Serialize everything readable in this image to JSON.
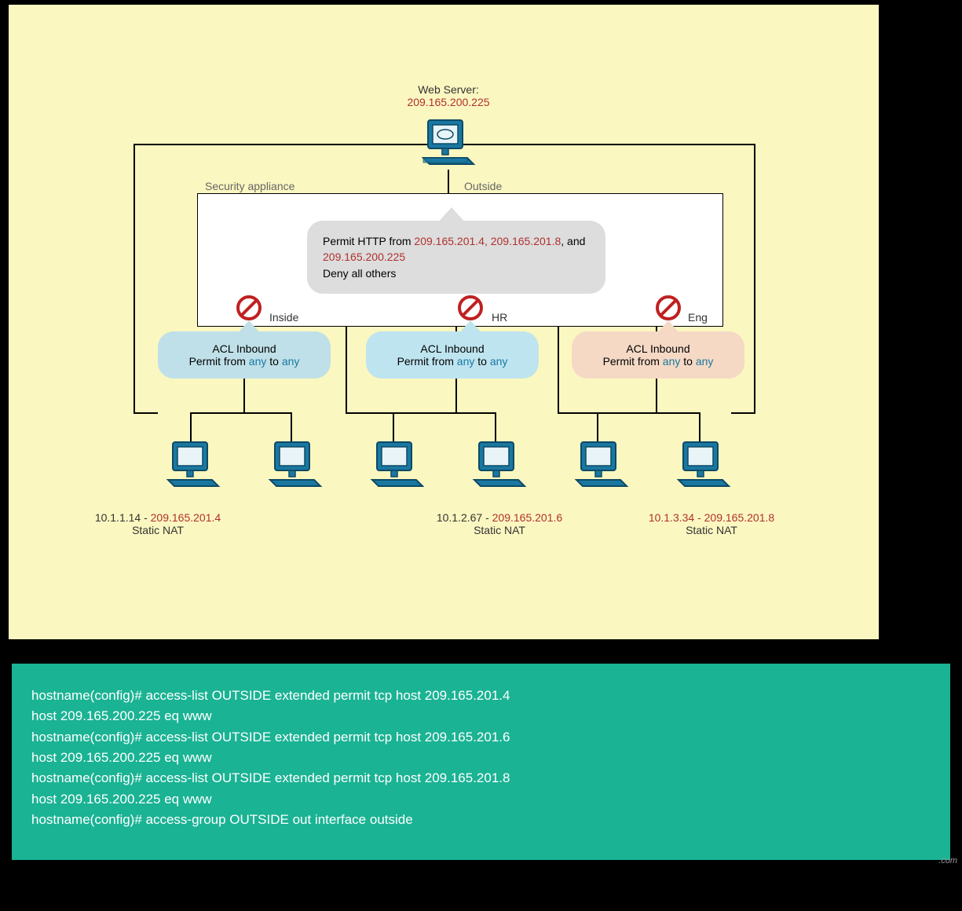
{
  "webserver": {
    "title": "Web Server:",
    "ip": "209.165.200.225"
  },
  "appliance": {
    "label_left": "Security appliance",
    "label_right": "Outside"
  },
  "callout": {
    "prefix": "Permit HTTP from ",
    "ip1": "209.165.201.4,",
    "ip2": "209.165.201.8",
    "mid": ", and ",
    "ip3": "209.165.200.225",
    "line2": "Deny all others"
  },
  "zones": {
    "inside": "Inside",
    "hr": "HR",
    "eng": "Eng"
  },
  "acl": {
    "title": "ACL Inbound",
    "prefix": "Permit from ",
    "any": "any",
    "sep": " to "
  },
  "hosts": {
    "h1_private": "10.1.1.14 - ",
    "h1_public": "209.165.201.4",
    "h2_private": "10.1.2.67 - ",
    "h2_public": "209.165.201.6",
    "h3_private": "10.1.3.34 - ",
    "h3_public": "209.165.201.8",
    "nat": "Static NAT"
  },
  "code": {
    "l1": "hostname(config)# access-list OUTSIDE extended permit tcp host 209.165.201.4",
    "l2": "host 209.165.200.225 eq www",
    "l3": "hostname(config)# access-list OUTSIDE extended permit tcp host 209.165.201.6",
    "l4": "host 209.165.200.225 eq www",
    "l5": "hostname(config)# access-list OUTSIDE extended permit tcp host 209.165.201.8",
    "l6": "host 209.165.200.225 eq www",
    "l7": "hostname(config)# access-group OUTSIDE out interface outside"
  },
  "watermark": ".com"
}
